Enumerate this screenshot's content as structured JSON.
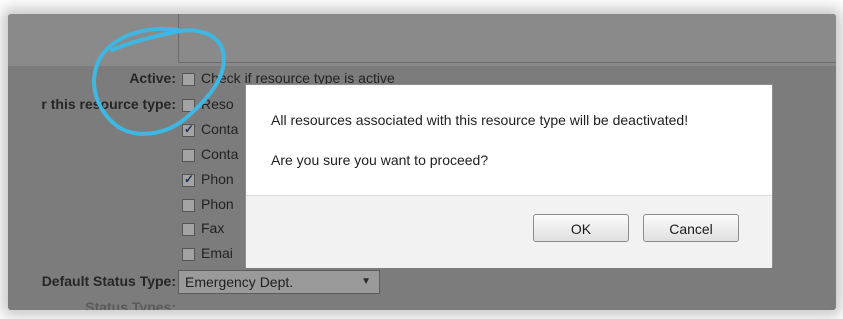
{
  "form": {
    "active_label": "Active:",
    "active_option": "Check if resource type is active",
    "resource_type_label": "r this resource type:",
    "options": [
      {
        "label": "Reso",
        "checked": false
      },
      {
        "label": "Conta",
        "checked": true
      },
      {
        "label": "Conta",
        "checked": false
      },
      {
        "label": "Phon",
        "checked": true
      },
      {
        "label": "Phon",
        "checked": false
      },
      {
        "label": "Fax",
        "checked": false
      },
      {
        "label": "Emai",
        "checked": false
      }
    ],
    "default_status_label": "Default Status Type:",
    "default_status_value": "Emergency Dept.",
    "status_types_label": "Status Types:"
  },
  "dialog": {
    "message": "All resources associated with this resource type will be deactivated!",
    "question": "Are you sure you want to proceed?",
    "ok_label": "OK",
    "cancel_label": "Cancel"
  },
  "annotation": {
    "color": "#3fb7e3"
  }
}
